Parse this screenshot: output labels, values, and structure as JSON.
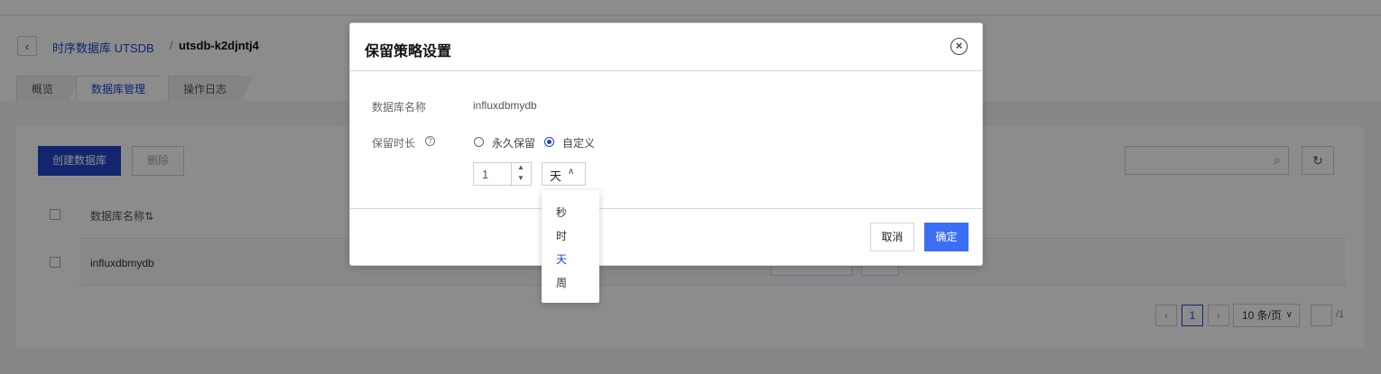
{
  "breadcrumb": {
    "back_icon": "chevron-left-icon",
    "parent": "时序数据库 UTSDB",
    "separator": "/",
    "current": "utsdb-k2djntj4"
  },
  "tabs": [
    {
      "label": "概览",
      "active": false
    },
    {
      "label": "数据库管理",
      "active": true
    },
    {
      "label": "操作日志",
      "active": false
    }
  ],
  "toolbar": {
    "create_label": "创建数据库",
    "delete_label": "删除",
    "search_placeholder": "",
    "search_icon": "search-icon",
    "refresh_icon": "refresh-icon"
  },
  "table": {
    "columns": [
      "数据库名称⇅"
    ],
    "rows": [
      {
        "name": "influxdbmydb"
      }
    ]
  },
  "pagination": {
    "current_page": "1",
    "page_size": "10 条/页",
    "total_pages": "/1"
  },
  "modal": {
    "title": "保留策略设置",
    "close_icon": "close-icon",
    "db_name_label": "数据库名称",
    "db_name_value": "influxdbmydb",
    "duration_label": "保留时长",
    "help_icon": "help-circle-icon",
    "options": [
      {
        "label": "永久保留",
        "checked": false
      },
      {
        "label": "自定义",
        "checked": true
      }
    ],
    "duration_value": "1",
    "unit_value": "天",
    "cancel_label": "取消",
    "ok_label": "确定"
  },
  "unit_dropdown": {
    "options": [
      "秒",
      "时",
      "天",
      "周"
    ],
    "selected": "天"
  },
  "colors": {
    "primary": "#1f45c8",
    "confirm": "#3b6ef5"
  }
}
